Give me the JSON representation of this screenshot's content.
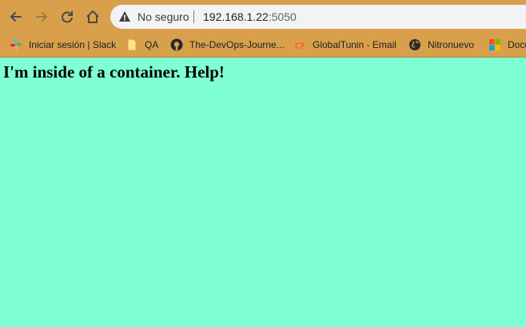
{
  "browser": {
    "address_bar": {
      "security_text": "No seguro",
      "host": "192.168.1.22",
      "port": ":5050"
    },
    "bookmarks": [
      {
        "label": "Iniciar sesión | Slack",
        "icon": "slack-icon"
      },
      {
        "label": "QA",
        "icon": "folder-icon"
      },
      {
        "label": "The-DevOps-Journe...",
        "icon": "github-icon"
      },
      {
        "label": "GlobalTunin - Email",
        "icon": "cpanel-icon"
      },
      {
        "label": "Nitronuevo",
        "icon": "globe-icon"
      },
      {
        "label": "Docu",
        "icon": "microsoft-icon"
      }
    ],
    "colors": {
      "toolbar": "#d9a04b",
      "page_background": "#7fffd4"
    }
  },
  "page": {
    "heading": "I'm inside of a container. Help!"
  }
}
